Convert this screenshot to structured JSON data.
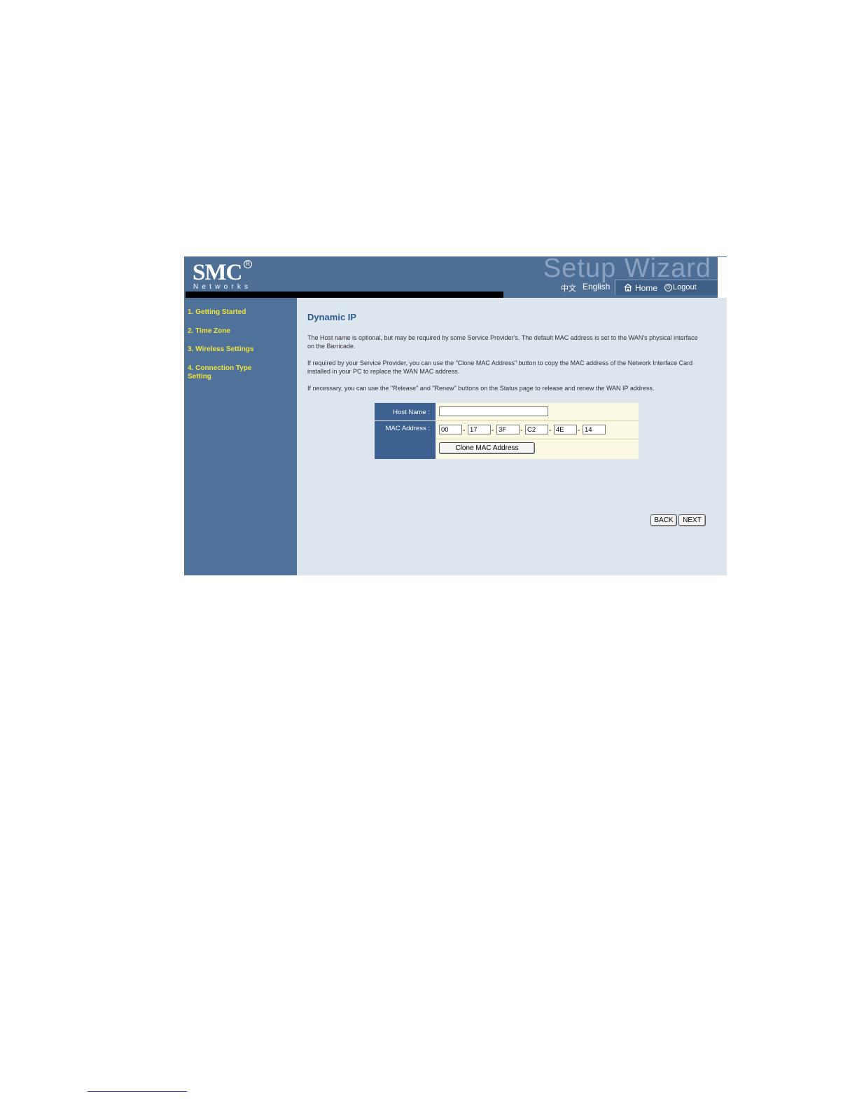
{
  "header": {
    "logo": {
      "main": "SMC",
      "registered": "R",
      "sub": "Networks"
    },
    "wizard_title": "Setup Wizard",
    "lang_zh": "中文",
    "lang_en": "English",
    "home": "Home",
    "logout": "Logout"
  },
  "sidebar": {
    "items": [
      {
        "label": "1. Getting Started"
      },
      {
        "label": "2. Time Zone"
      },
      {
        "label": "3. Wireless Settings"
      },
      {
        "label": "4. Connection Type Setting"
      }
    ]
  },
  "main": {
    "title": "Dynamic IP",
    "paragraphs": [
      "The Host name is optional, but may be required by some Service Provider's. The default MAC address is set to the WAN's physical interface on the Barricade.",
      "If required by your Service Provider, you can use the \"Clone MAC Address\" button to copy the MAC address of the Network Interface Card installed in your PC to replace the WAN MAC address.",
      "If necessary, you can use the \"Release\" and \"Renew\" buttons on the Status page to release and renew the WAN IP address."
    ],
    "form": {
      "host_name_label": "Host Name :",
      "host_name_value": "",
      "mac_label": "MAC Address :",
      "mac_octets": [
        "00",
        "17",
        "3F",
        "C2",
        "4E",
        "14"
      ],
      "dash": "-",
      "clone_button": "Clone MAC Address"
    },
    "back_button": "BACK",
    "next_button": "NEXT"
  }
}
